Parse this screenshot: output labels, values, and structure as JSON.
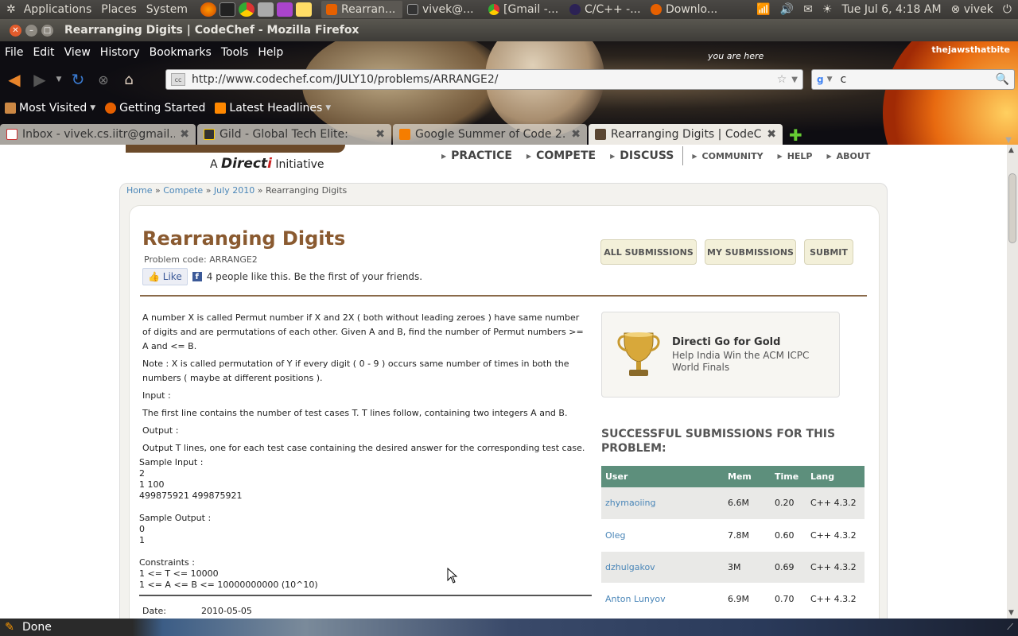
{
  "panel": {
    "menus": [
      "Applications",
      "Places",
      "System"
    ],
    "tasks": [
      {
        "label": "Rearran...",
        "color": "#e66000"
      },
      {
        "label": "vivek@...",
        "color": "#333333"
      },
      {
        "label": "[Gmail -...",
        "color": "#4285f4"
      },
      {
        "label": "C/C++ -...",
        "color": "#2c2255"
      },
      {
        "label": "Downlo...",
        "color": "#e66000"
      }
    ],
    "clock": "Tue Jul  6,  4:18 AM",
    "user": "vivek"
  },
  "window": {
    "title": "Rearranging Digits | CodeChef - Mozilla Firefox"
  },
  "menubar": [
    "File",
    "Edit",
    "View",
    "History",
    "Bookmarks",
    "Tools",
    "Help"
  ],
  "persona": {
    "label": "thejawsthatbite",
    "here": "you are here"
  },
  "navbar": {
    "url": "http://www.codechef.com/JULY10/problems/ARRANGE2/",
    "search_value": "c"
  },
  "bookmarks": [
    "Most Visited",
    "Getting Started",
    "Latest Headlines"
  ],
  "tabs": [
    {
      "label": "Inbox - vivek.cs.iitr@gmail....",
      "icon_color": "#c33"
    },
    {
      "label": "Gild - Global Tech Elite:",
      "icon_color": "#333"
    },
    {
      "label": "Google Summer of Code 2...",
      "icon_color": "#f57d00"
    },
    {
      "label": "Rearranging Digits | CodeC...",
      "icon_color": "#5a4632"
    }
  ],
  "site": {
    "a": "A",
    "brand_pre": "Direct",
    "brand_i": "i",
    "initiative": "Initiative",
    "nav_main": [
      "PRACTICE",
      "COMPETE",
      "DISCUSS"
    ],
    "nav_small": [
      "COMMUNITY",
      "HELP",
      "ABOUT"
    ]
  },
  "breadcrumb": {
    "home": "Home",
    "compete": "Compete",
    "contest": "July 2010",
    "current": "Rearranging Digits",
    "sep": "»"
  },
  "problem": {
    "title": "Rearranging Digits",
    "code": "Problem code: ARRANGE2",
    "like_label": "Like",
    "like_text": "4 people like this. Be the first of your friends.",
    "buttons": [
      "ALL SUBMISSIONS",
      "MY SUBMISSIONS",
      "SUBMIT"
    ],
    "statement": [
      "A number X is called Permut number if X and 2X ( both without leading zeroes ) have same number of digits and are permutations of each other. Given A and B, find the number of Permut numbers >= A and <= B.",
      "Note : X is called permutation of Y if every digit ( 0 - 9 ) occurs same number of times in both the numbers ( maybe at different positions ).",
      "Input :",
      "The first line contains the number of test cases T. T lines follow, containing two integers A and B.",
      "Output :",
      "Output T lines, one for each test case containing the desired answer for the corresponding test case."
    ],
    "sample_input_label": "Sample Input :",
    "sample_input": [
      "2",
      "1 100",
      "499875921 499875921"
    ],
    "sample_output_label": "Sample Output :",
    "sample_output": [
      "0",
      "1"
    ],
    "constraints_label": "Constraints :",
    "constraints": [
      "1 <= T <= 10000",
      "1 <= A <= B <= 10000000000 (10^10)"
    ],
    "date_label": "Date:",
    "date_value": "2010-05-05"
  },
  "promo": {
    "title": "Directi Go for Gold",
    "subtitle": "Help India Win the ACM ICPC World Finals"
  },
  "submissions": {
    "heading": "SUCCESSFUL SUBMISSIONS FOR THIS PROBLEM:",
    "columns": [
      "User",
      "Mem",
      "Time",
      "Lang"
    ],
    "rows": [
      [
        "zhymaoiing",
        "6.6M",
        "0.20",
        "C++ 4.3.2"
      ],
      [
        "Oleg",
        "7.8M",
        "0.60",
        "C++ 4.3.2"
      ],
      [
        "dzhulgakov",
        "3M",
        "0.69",
        "C++ 4.3.2"
      ],
      [
        "Anton Lunyov",
        "6.9M",
        "0.70",
        "C++ 4.3.2"
      ]
    ]
  },
  "status": {
    "text": "Done"
  }
}
